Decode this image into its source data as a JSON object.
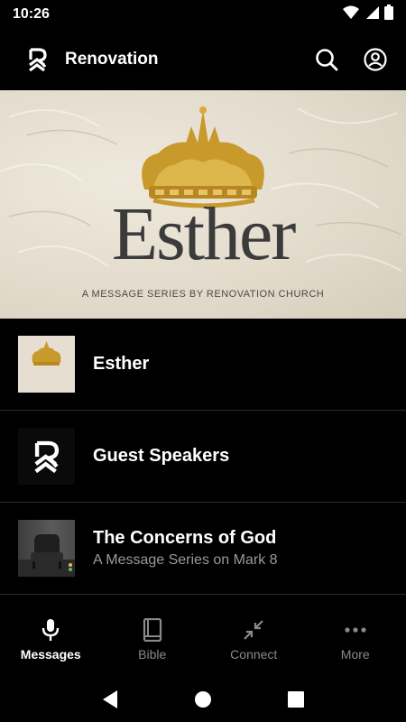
{
  "status": {
    "time": "10:26",
    "icons": [
      "wifi-icon",
      "cell-signal-icon",
      "battery-icon"
    ]
  },
  "app_bar": {
    "title": "Renovation",
    "logo": "renovation-logo",
    "actions": [
      "search-icon",
      "account-icon"
    ]
  },
  "hero": {
    "title": "Esther",
    "subtitle": "A MESSAGE SERIES BY RENOVATION CHURCH",
    "dots": 5,
    "active_dot": 0,
    "accent_gold": "#c89a2c"
  },
  "list": {
    "items": [
      {
        "title": "Esther",
        "subtitle": "",
        "thumb": "esther-crown"
      },
      {
        "title": "Guest Speakers",
        "subtitle": "",
        "thumb": "renovation-logo"
      },
      {
        "title": "The Concerns of God",
        "subtitle": "A Message Series on Mark 8",
        "thumb": "chair-photo"
      }
    ]
  },
  "bottom_nav": {
    "items": [
      {
        "label": "Messages",
        "icon": "microphone-icon",
        "active": true
      },
      {
        "label": "Bible",
        "icon": "book-icon",
        "active": false
      },
      {
        "label": "Connect",
        "icon": "connect-arrows-icon",
        "active": false
      },
      {
        "label": "More",
        "icon": "more-dots-icon",
        "active": false
      }
    ]
  },
  "system_nav": [
    "back-icon",
    "home-icon",
    "recents-icon"
  ],
  "colors": {
    "background": "#000000",
    "text": "#ffffff",
    "muted": "#9a9a9a",
    "divider": "#2a2a2a"
  }
}
